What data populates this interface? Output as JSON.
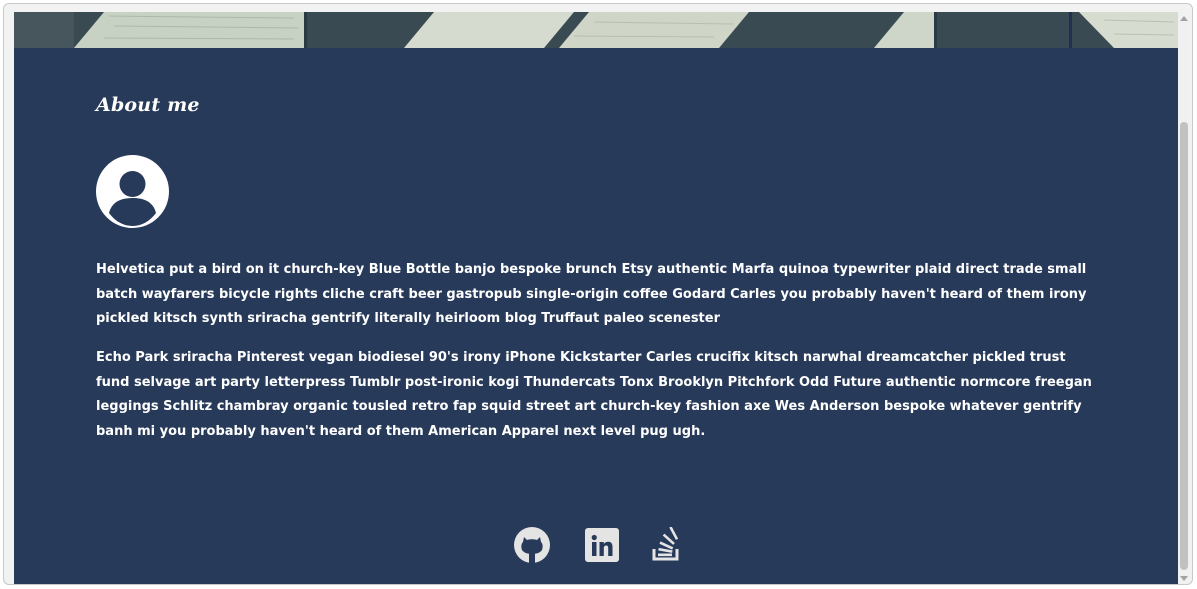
{
  "about": {
    "heading": "About me",
    "paragraphs": [
      "Helvetica put a bird on it church-key Blue Bottle banjo bespoke brunch Etsy authentic Marfa quinoa typewriter plaid direct trade small batch wayfarers bicycle rights cliche craft beer gastropub single-origin coffee Godard Carles you probably haven't heard of them irony pickled kitsch synth sriracha gentrify literally heirloom blog Truffaut paleo scenester",
      "Echo Park sriracha Pinterest vegan biodiesel 90's irony iPhone Kickstarter Carles crucifix kitsch narwhal dreamcatcher pickled trust fund selvage art party letterpress Tumblr post-ironic kogi Thundercats Tonx Brooklyn Pitchfork Odd Future authentic normcore freegan leggings Schlitz chambray organic tousled retro fap squid street art church-key fashion axe Wes Anderson bespoke whatever gentrify banh mi you probably haven't heard of them American Apparel next level pug ugh."
    ]
  },
  "social": {
    "icons": [
      "github-icon",
      "linkedin-icon",
      "stackoverflow-icon"
    ]
  },
  "colors": {
    "background": "#283a5a",
    "text": "#ffffff",
    "icon": "#e4e4e4"
  }
}
